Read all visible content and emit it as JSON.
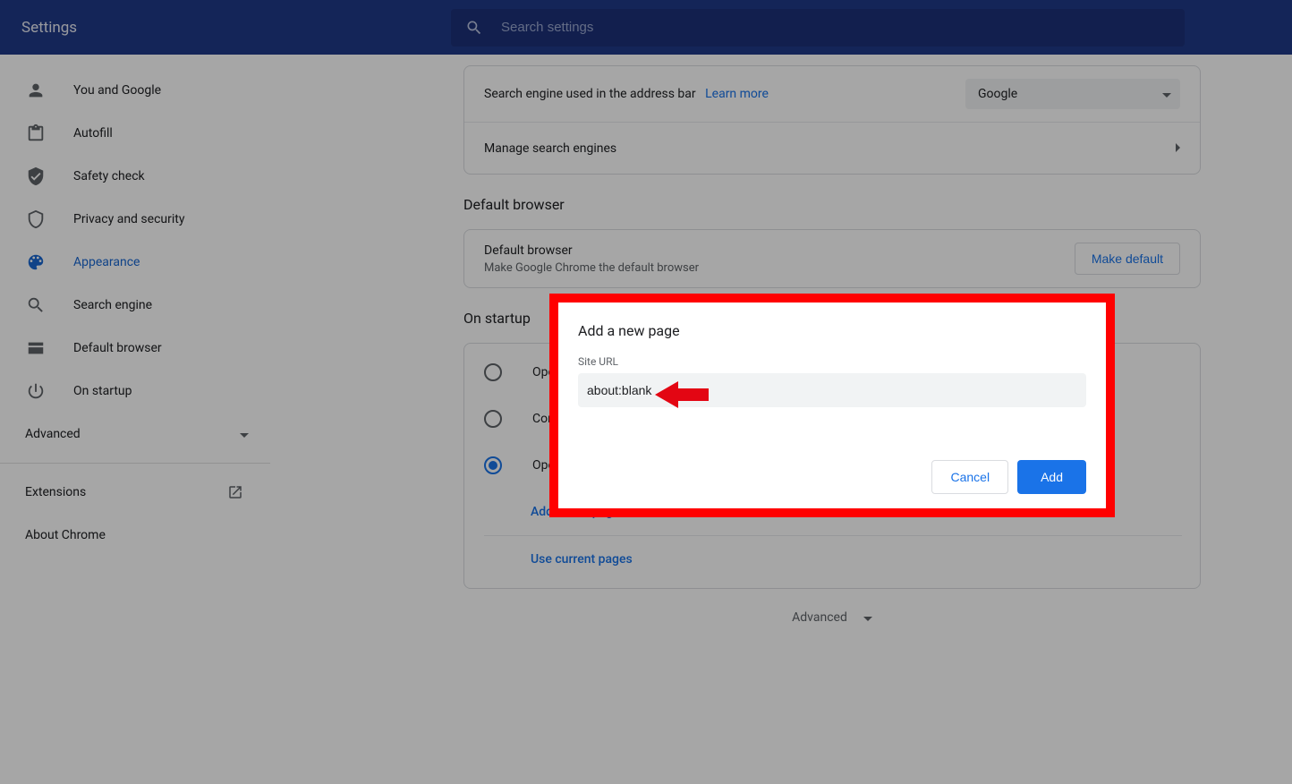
{
  "header": {
    "title": "Settings",
    "search_placeholder": "Search settings"
  },
  "sidebar": {
    "items": [
      {
        "label": "You and Google"
      },
      {
        "label": "Autofill"
      },
      {
        "label": "Safety check"
      },
      {
        "label": "Privacy and security"
      },
      {
        "label": "Appearance"
      },
      {
        "label": "Search engine"
      },
      {
        "label": "Default browser"
      },
      {
        "label": "On startup"
      }
    ],
    "advanced": "Advanced",
    "extensions": "Extensions",
    "about": "About Chrome"
  },
  "search_engine": {
    "address_bar_label": "Search engine used in the address bar",
    "learn_more": "Learn more",
    "selected": "Google",
    "manage": "Manage search engines"
  },
  "default_browser": {
    "section_title": "Default browser",
    "row_title": "Default browser",
    "row_sub": "Make Google Chrome the default browser",
    "button": "Make default"
  },
  "startup": {
    "section_title": "On startup",
    "opt_new_tab": "Ope",
    "opt_continue": "Con",
    "opt_specific": "Open a specific page or set of pages",
    "add_page": "Add a new page",
    "use_current": "Use current pages"
  },
  "bottom_advanced": "Advanced",
  "dialog": {
    "title": "Add a new page",
    "field_label": "Site URL",
    "value": "about:blank",
    "cancel": "Cancel",
    "add": "Add"
  }
}
